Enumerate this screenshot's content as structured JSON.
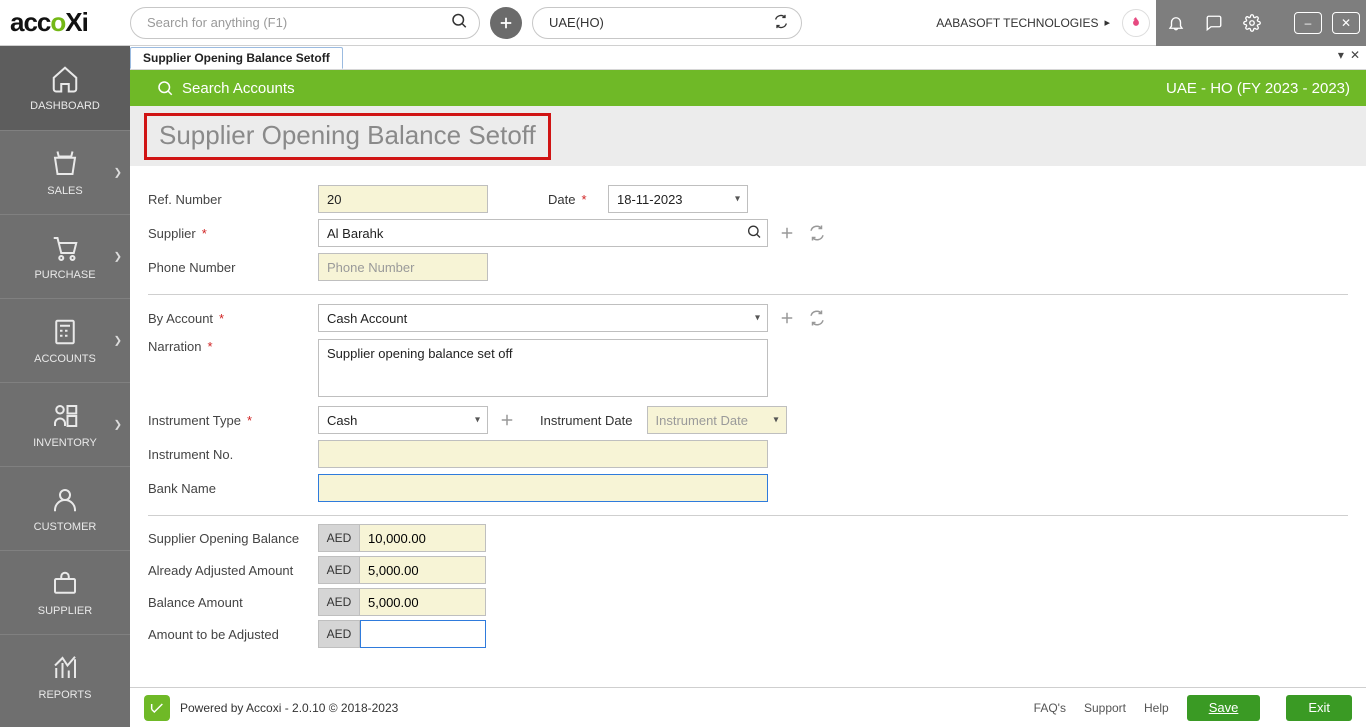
{
  "top": {
    "search_placeholder": "Search for anything (F1)",
    "company": "UAE(HO)",
    "org": "AABASOFT TECHNOLOGIES"
  },
  "tab": {
    "title": "Supplier Opening Balance Setoff"
  },
  "sidebar": {
    "items": [
      {
        "label": "DASHBOARD"
      },
      {
        "label": "SALES"
      },
      {
        "label": "PURCHASE"
      },
      {
        "label": "ACCOUNTS"
      },
      {
        "label": "INVENTORY"
      },
      {
        "label": "CUSTOMER"
      },
      {
        "label": "SUPPLIER"
      },
      {
        "label": "REPORTS"
      }
    ]
  },
  "greenbar": {
    "search_accounts": "Search Accounts",
    "context": "UAE - HO (FY 2023 - 2023)"
  },
  "page_title": "Supplier Opening Balance Setoff",
  "labels": {
    "ref_number": "Ref. Number",
    "date": "Date",
    "supplier": "Supplier",
    "phone": "Phone Number",
    "phone_placeholder": "Phone Number",
    "by_account": "By Account",
    "narration": "Narration",
    "instrument_type": "Instrument Type",
    "instrument_date": "Instrument Date",
    "instrument_date_placeholder": "Instrument Date",
    "instrument_no": "Instrument No.",
    "bank_name": "Bank Name",
    "supplier_opening_balance": "Supplier Opening Balance",
    "already_adjusted": "Already Adjusted Amount",
    "balance_amount": "Balance Amount",
    "amount_to_be_adjusted": "Amount to be Adjusted"
  },
  "values": {
    "ref_number": "20",
    "date": "18-11-2023",
    "supplier": "Al Barahk",
    "phone": "",
    "by_account": "Cash Account",
    "narration": "Supplier opening balance set off",
    "instrument_type": "Cash",
    "instrument_date": "",
    "instrument_no": "",
    "bank_name": "",
    "currency": "AED",
    "supplier_opening_balance": "10,000.00",
    "already_adjusted": "5,000.00",
    "balance_amount": "5,000.00",
    "amount_to_be_adjusted": ""
  },
  "footer": {
    "powered": "Powered by Accoxi - 2.0.10 © 2018-2023",
    "faq": "FAQ's",
    "support": "Support",
    "help": "Help",
    "save": "Save",
    "exit": "Exit"
  }
}
